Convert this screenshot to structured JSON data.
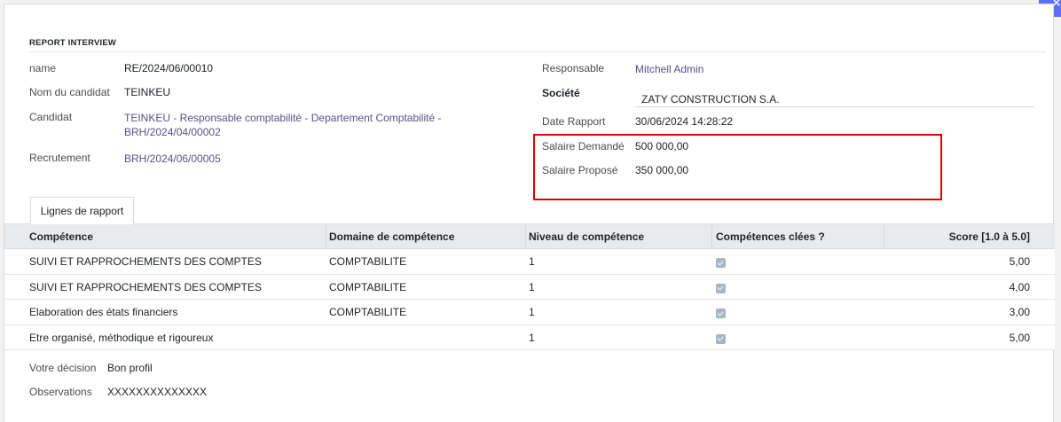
{
  "section_title": "REPORT INTERVIEW",
  "left_fields": {
    "name_label": "name",
    "name_value": "RE/2024/06/00010",
    "candidate_name_label": "Nom du candidat",
    "candidate_name_value": "TEINKEU",
    "candidate_label": "Candidat",
    "candidate_value_line1": "TEINKEU - Responsable comptabilité - Departement Comptabilité -",
    "candidate_value_line2": "BRH/2024/04/00002",
    "recruitment_label": "Recrutement",
    "recruitment_value": "BRH/2024/06/00005"
  },
  "right_fields": {
    "responsible_label": "Responsable",
    "responsible_value": "Mitchell Admin",
    "company_label": "Société",
    "company_value": "ZATY CONSTRUCTION S.A.",
    "report_date_label": "Date Rapport",
    "report_date_value": "30/06/2024 14:28:22",
    "salary_requested_label": "Salaire Demandé",
    "salary_requested_value": "500 000,00",
    "salary_offered_label": "Salaire Proposé",
    "salary_offered_value": "350 000,00"
  },
  "tab_label": "Lignes de rapport",
  "table": {
    "headers": [
      "Compétence",
      "Domaine de compétence",
      "Niveau de compétence",
      "Compétences clées ?",
      "Score [1.0 à 5.0]"
    ],
    "rows": [
      {
        "competence": "SUIVI ET RAPPROCHEMENTS DES COMPTES",
        "domain": "COMPTABILITE",
        "level": "1",
        "key": true,
        "score": "5,00"
      },
      {
        "competence": "SUIVI ET RAPPROCHEMENTS DES COMPTES",
        "domain": "COMPTABILITE",
        "level": "1",
        "key": true,
        "score": "4,00"
      },
      {
        "competence": "Elaboration des états financiers",
        "domain": "COMPTABILITE",
        "level": "1",
        "key": true,
        "score": "3,00"
      },
      {
        "competence": "Etre organisé, méthodique et rigoureux",
        "domain": "",
        "level": "1",
        "key": true,
        "score": "5,00"
      }
    ]
  },
  "footer": {
    "decision_label": "Votre décision",
    "decision_value": "Bon profil",
    "observations_label": "Observations",
    "observations_value": "XXXXXXXXXXXXXX"
  },
  "colors": {
    "highlight": "#e00000",
    "link": "#5d4f85",
    "corner_button": "#5b6ef5"
  }
}
